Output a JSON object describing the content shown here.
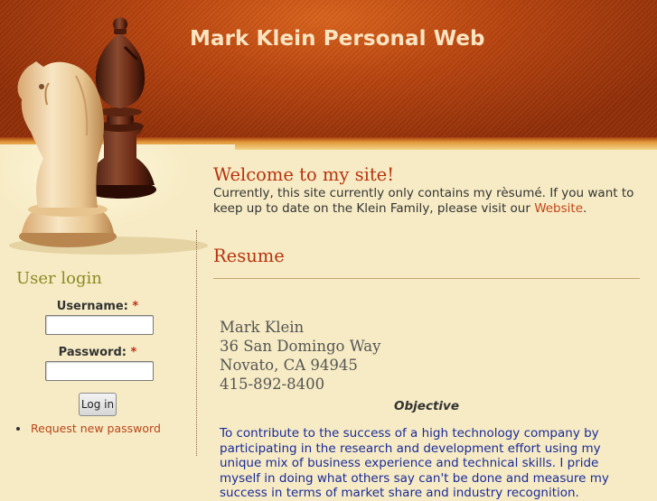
{
  "header": {
    "site_title": "Mark Klein Personal Web"
  },
  "sidebar": {
    "title": "User login",
    "username_label": "Username:",
    "password_label": "Password:",
    "required_mark": "*",
    "login_button": "Log in",
    "links": [
      "Request new password"
    ]
  },
  "welcome": {
    "title": "Welcome to my site!",
    "text_before_link": "Currently, this site currently only contains my rèsumé. If you want to keep up to date on the Klein Family, please visit our ",
    "link_text": "Website",
    "text_after_link": "."
  },
  "resume": {
    "title": "Resume",
    "address_lines": [
      "Mark Klein",
      "36 San Domingo Way",
      "Novato, CA 94945",
      "415-892-8400"
    ],
    "objective_heading": "Objective",
    "objective_text": "To contribute to the success of a high technology company by participating in the research and development effort using my unique mix of business experience and technical skills. I pride myself in doing what others say can't be done and measure my success in terms of market share and industry recognition."
  },
  "colors": {
    "header": "#b8440f",
    "title_text": "#fbe4c0",
    "heading": "#b7340f",
    "link": "#c4451a",
    "background": "#f6ebc4"
  }
}
